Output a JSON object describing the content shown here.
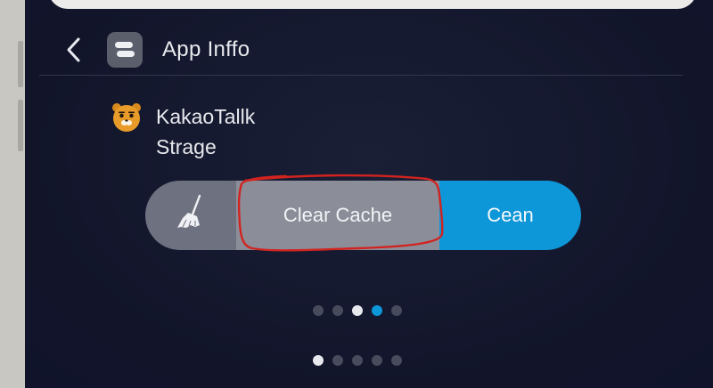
{
  "header": {
    "title": "App Inffo"
  },
  "app": {
    "name": "KakaoTallk",
    "subtitle": "Strage"
  },
  "actions": {
    "clear_label": "Clear Cache",
    "clean_label": "Cean"
  },
  "pager_top": {
    "count": 5,
    "white_index": 2,
    "active_index": 3
  },
  "pager_bottom": {
    "count": 5,
    "active_index": 0
  },
  "colors": {
    "accent": "#0d96d8",
    "annotation": "#d2231f",
    "background": "#14172a"
  },
  "icons": {
    "back": "chevron-left-icon",
    "app": "app-info-icon",
    "kakao": "kakao-ryan-icon",
    "broom": "broom-icon"
  }
}
